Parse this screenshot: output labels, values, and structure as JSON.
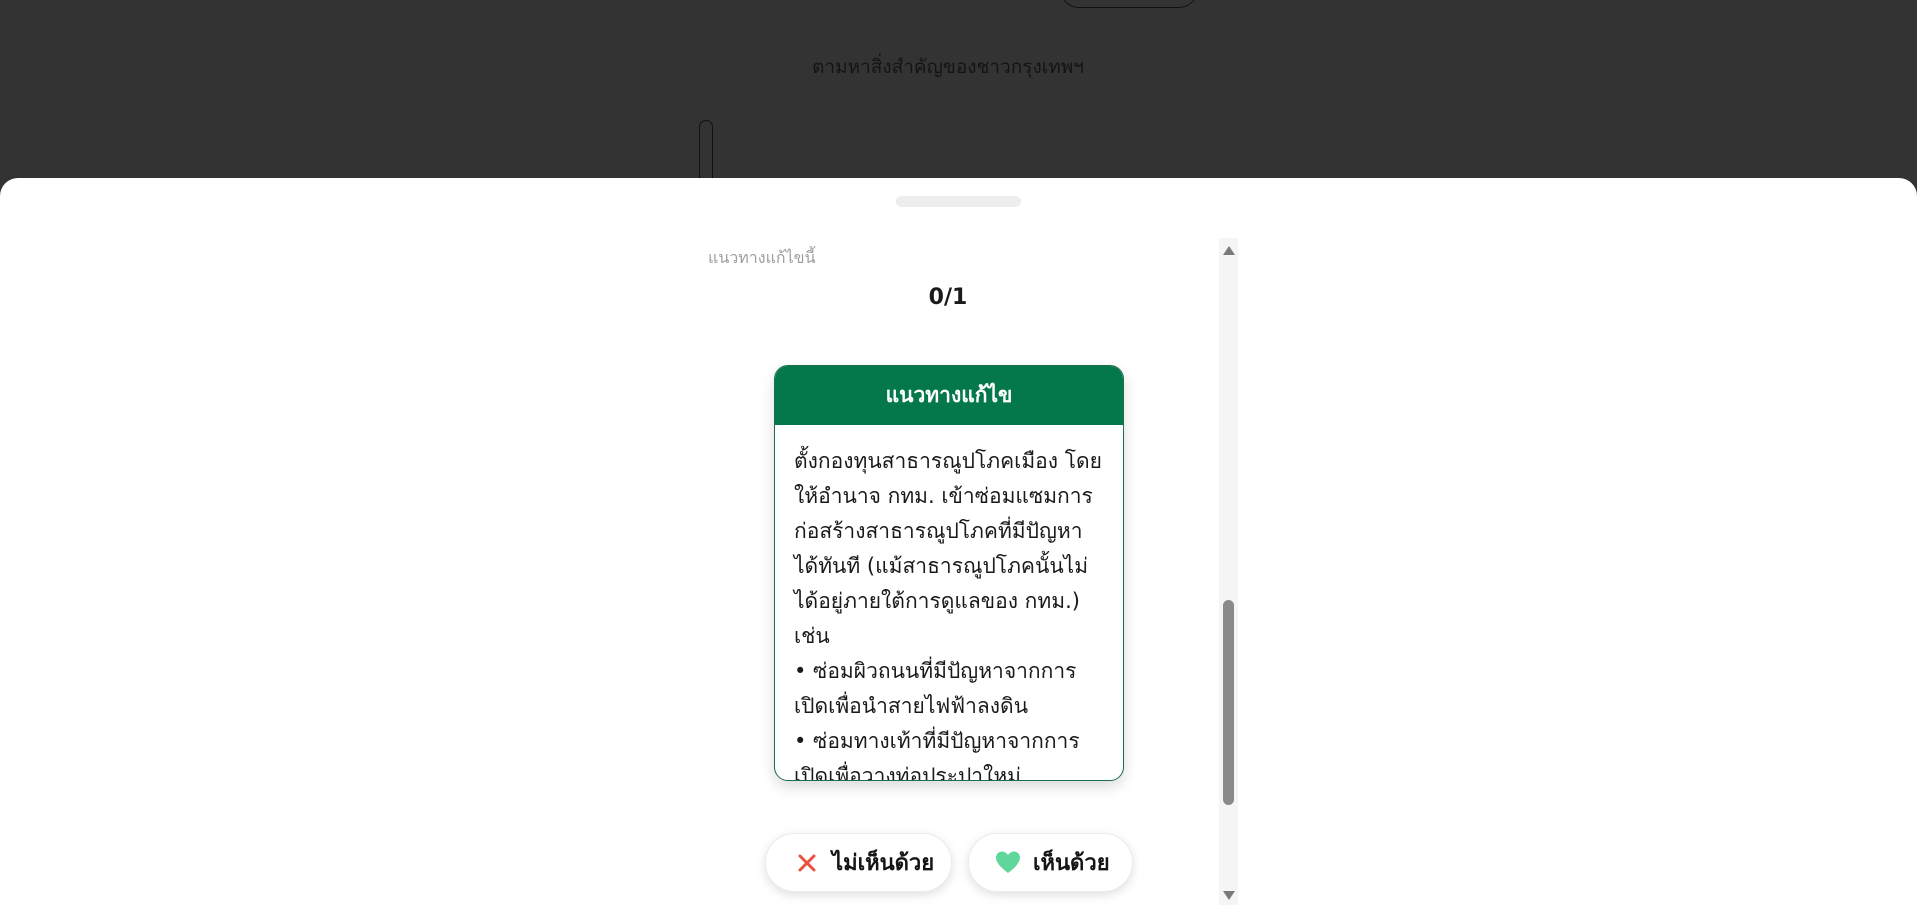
{
  "background": {
    "subtitle": "ตามหาสิ่งสำคัญของชาวกรุงเทพฯ"
  },
  "sheet": {
    "section_label": "แนวทางแก้ไขนี้",
    "counter": "0/1",
    "card": {
      "title": "แนวทางแก้ไข",
      "intro": "ตั้งกองทุนสาธารณูปโภคเมือง โดยให้อำนาจ กทม. เข้าซ่อมแซมการก่อสร้างสาธารณูปโภคที่มีปัญหาได้ทันที (แม้สาธารณูปโภคนั้นไม่ได้อยู่ภายใต้การดูแลของ กทม.) เช่น",
      "bullets": [
        "• ซ่อมผิวถนนที่มีปัญหาจากการเปิดเพื่อนำสายไฟฟ้าลงดิน",
        "• ซ่อมทางเท้าที่มีปัญหาจากการเปิดเพื่อวางท่อประปาใหม่"
      ],
      "accent_color": "#04784b"
    },
    "buttons": {
      "disagree_label": "ไม่เห็นด้วย",
      "disagree_icon": "close-icon",
      "disagree_icon_color": "#e8523f",
      "agree_label": "เห็นด้วย",
      "agree_icon": "heart-icon",
      "agree_icon_color": "#5fd69a"
    }
  }
}
